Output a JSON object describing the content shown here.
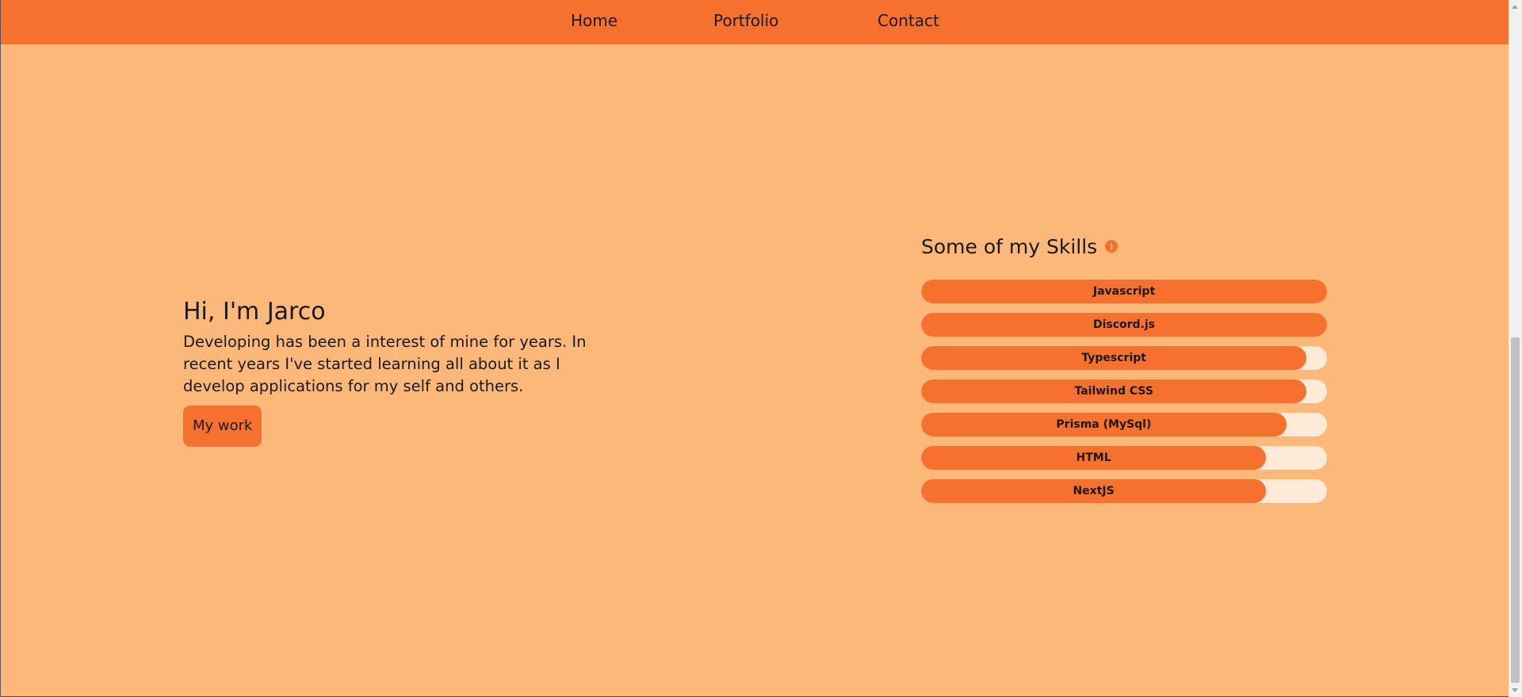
{
  "nav": {
    "items": [
      {
        "label": "Home"
      },
      {
        "label": "Portfolio"
      },
      {
        "label": "Contact"
      }
    ]
  },
  "hero": {
    "title": "Hi, I'm Jarco",
    "text": "Developing has been a interest of mine for years. In recent years I've started learning all about it as I develop applications for my self and others.",
    "button_label": "My work"
  },
  "skills": {
    "title": "Some of my Skills",
    "info_icon": "info-icon",
    "items": [
      {
        "label": "Javascript",
        "level": 100
      },
      {
        "label": "Discord.js",
        "level": 100
      },
      {
        "label": "Typescript",
        "level": 95
      },
      {
        "label": "Tailwind CSS",
        "level": 95
      },
      {
        "label": "Prisma (MySql)",
        "level": 90
      },
      {
        "label": "HTML",
        "level": 85
      },
      {
        "label": "NextJS",
        "level": 85
      }
    ]
  },
  "colors": {
    "background": "#fbb879",
    "accent": "#f5712d",
    "bar_track": "#fdebd8"
  }
}
